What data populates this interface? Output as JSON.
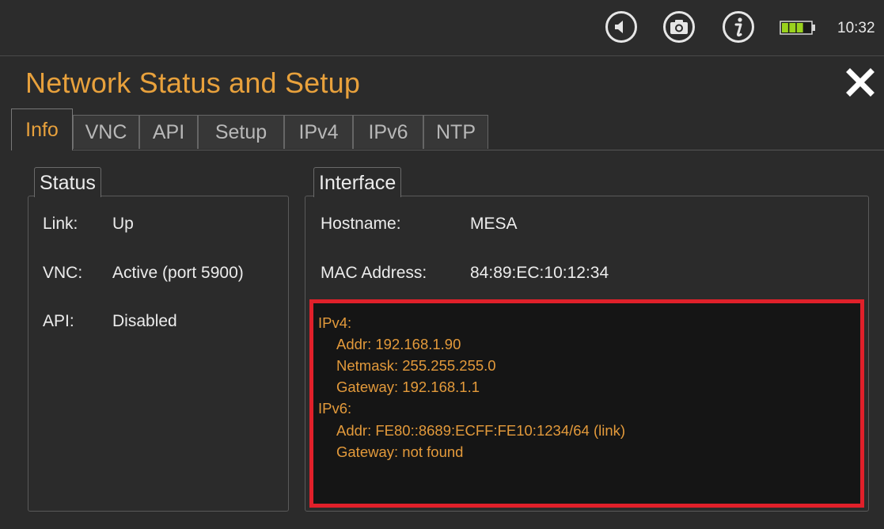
{
  "statusbar": {
    "sound_icon": "speaker-icon",
    "camera_icon": "camera-icon",
    "info_icon": "info-icon",
    "battery_icon": "battery-icon",
    "battery_level": 0.75,
    "time": "10:32"
  },
  "header": {
    "title": "Network Status and Setup",
    "close_icon": "close-icon"
  },
  "tabs": [
    {
      "label": "Info",
      "active": true
    },
    {
      "label": "VNC",
      "active": false
    },
    {
      "label": "API",
      "active": false
    },
    {
      "label": "Setup",
      "active": false
    },
    {
      "label": "IPv4",
      "active": false
    },
    {
      "label": "IPv6",
      "active": false
    },
    {
      "label": "NTP",
      "active": false
    }
  ],
  "status": {
    "title": "Status",
    "rows": [
      {
        "key": "Link:",
        "value": "Up"
      },
      {
        "key": "VNC:",
        "value": "Active (port 5900)"
      },
      {
        "key": "API:",
        "value": "Disabled"
      }
    ]
  },
  "interface": {
    "title": "Interface",
    "rows": [
      {
        "key": "Hostname:",
        "value": "MESA"
      },
      {
        "key": "MAC Address:",
        "value": "84:89:EC:10:12:34"
      }
    ],
    "ip_lines": [
      "IPv4:",
      "Addr: 192.168.1.90",
      "Netmask: 255.255.255.0",
      "Gateway: 192.168.1.1",
      "IPv6:",
      "Addr: FE80::8689:ECFF:FE10:1234/64 (link)",
      "Gateway: not found"
    ]
  },
  "colors": {
    "accent": "#e8a13c",
    "highlight_border": "#e0202a",
    "background": "#2b2b2b"
  }
}
